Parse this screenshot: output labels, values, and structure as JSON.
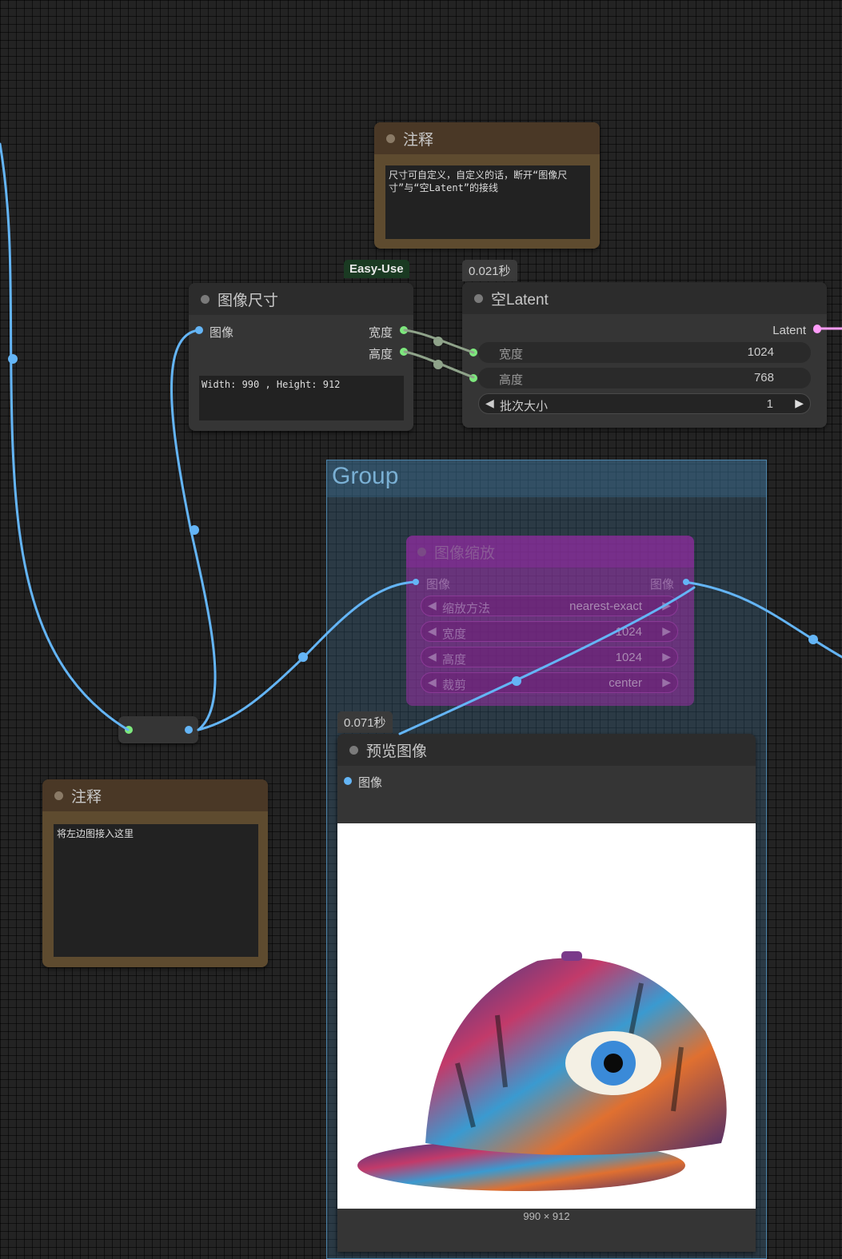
{
  "note_top": {
    "title": "注释",
    "text": "尺寸可自定义，自定义的话，断开“图像尺寸”与“空Latent”的接线"
  },
  "note_left": {
    "title": "注释",
    "text": "将左边图接入这里"
  },
  "image_size_node": {
    "badge": "Easy-Use",
    "title": "图像尺寸",
    "input_label": "图像",
    "output_width": "宽度",
    "output_height": "高度",
    "info_text": "Width: 990 , Height: 912"
  },
  "empty_latent_node": {
    "timing": "0.021秒",
    "title": "空Latent",
    "output_label": "Latent",
    "width_label": "宽度",
    "width_value": "1024",
    "height_label": "高度",
    "height_value": "768",
    "batch_label": "批次大小",
    "batch_value": "1"
  },
  "group": {
    "title": "Group"
  },
  "image_scale_node": {
    "title": "图像缩放",
    "input_label": "图像",
    "output_label": "图像",
    "method_label": "缩放方法",
    "method_value": "nearest-exact",
    "width_label": "宽度",
    "width_value": "1024",
    "height_label": "高度",
    "height_value": "1024",
    "crop_label": "裁剪",
    "crop_value": "center"
  },
  "preview_node": {
    "timing": "0.071秒",
    "title": "预览图像",
    "input_label": "图像",
    "image_size": "990 × 912"
  },
  "colors": {
    "image_link": "#64b5f6",
    "int_link": "#8fa38a",
    "latent_link": "#ff9cf9",
    "group_fill": "#3f789e",
    "bypass_purple": "#9b30a8"
  },
  "icons": [
    "arrow-left-icon",
    "arrow-right-icon"
  ]
}
